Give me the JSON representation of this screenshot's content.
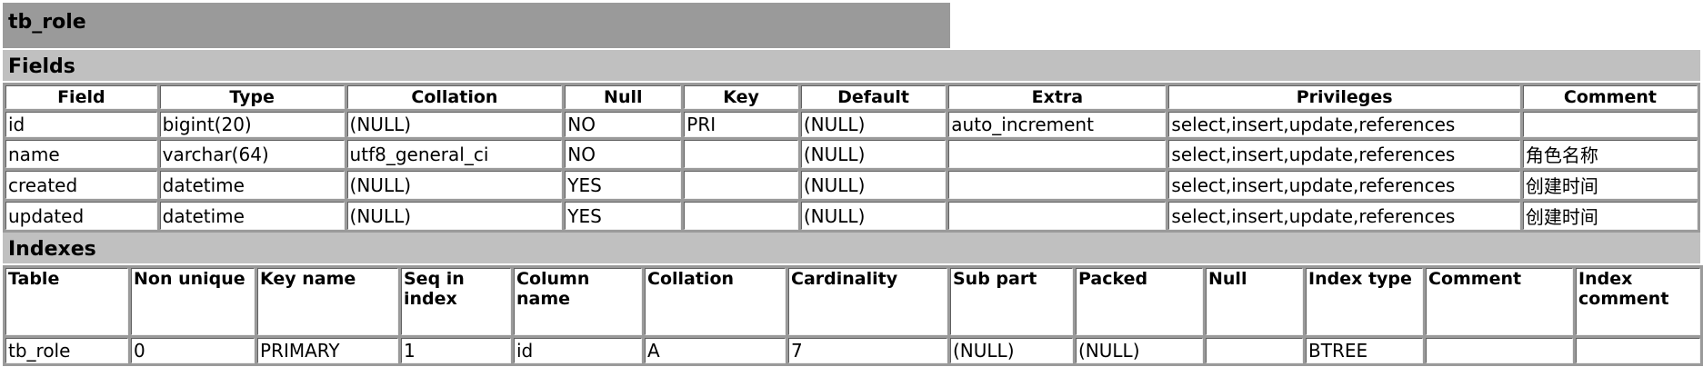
{
  "table_name": "tb_role",
  "fields": {
    "section_title": "Fields",
    "columns": [
      "Field",
      "Type",
      "Collation",
      "Null",
      "Key",
      "Default",
      "Extra",
      "Privileges",
      "Comment"
    ],
    "rows": [
      [
        "id",
        "bigint(20)",
        "(NULL)",
        "NO",
        "PRI",
        "(NULL)",
        "auto_increment",
        "select,insert,update,references",
        ""
      ],
      [
        "name",
        "varchar(64)",
        "utf8_general_ci",
        "NO",
        "",
        "(NULL)",
        "",
        "select,insert,update,references",
        "角色名称"
      ],
      [
        "created",
        "datetime",
        "(NULL)",
        "YES",
        "",
        "(NULL)",
        "",
        "select,insert,update,references",
        "创建时间"
      ],
      [
        "updated",
        "datetime",
        "(NULL)",
        "YES",
        "",
        "(NULL)",
        "",
        "select,insert,update,references",
        "创建时间"
      ]
    ]
  },
  "indexes": {
    "section_title": "Indexes",
    "columns": [
      "Table",
      "Non unique",
      "Key name",
      "Seq in index",
      "Column name",
      "Collation",
      "Cardinality",
      "Sub part",
      "Packed",
      "Null",
      "Index type",
      "Comment",
      "Index comment"
    ],
    "rows": [
      [
        "tb_role",
        "0",
        "PRIMARY",
        "1",
        "id",
        "A",
        "7",
        "(NULL)",
        "(NULL)",
        "",
        "BTREE",
        "",
        ""
      ]
    ]
  },
  "colors": {
    "title_bar": "#9a9a9a",
    "section_bar": "#c0c0c0",
    "grid": "#9a9a9a"
  }
}
